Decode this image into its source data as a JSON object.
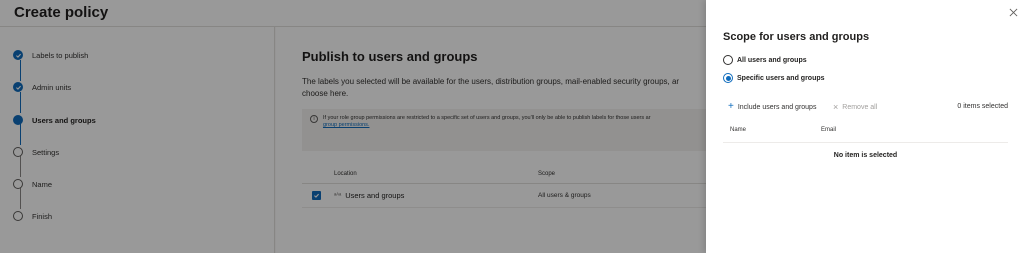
{
  "page": {
    "title": "Create policy"
  },
  "steps": [
    {
      "label": "Labels to publish",
      "state": "done"
    },
    {
      "label": "Admin units",
      "state": "done"
    },
    {
      "label": "Users and groups",
      "state": "current"
    },
    {
      "label": "Settings",
      "state": "pending"
    },
    {
      "label": "Name",
      "state": "pending"
    },
    {
      "label": "Finish",
      "state": "pending"
    }
  ],
  "main": {
    "title": "Publish to users and groups",
    "description": "The labels you selected will be available for the users, distribution groups, mail-enabled security groups, ar choose here.",
    "info_text": "If your role group permissions are restricted to a specific set of users and groups, you'll only be able to publish labels for those users ar",
    "info_link": "group permissions.",
    "table": {
      "headers": {
        "location": "Location",
        "scope": "Scope"
      },
      "rows": [
        {
          "location": "Users and groups",
          "scope": "All users & groups",
          "checked": true
        }
      ]
    }
  },
  "panel": {
    "title": "Scope for users and groups",
    "options": [
      {
        "label": "All users and groups",
        "checked": false
      },
      {
        "label": "Specific users and groups",
        "checked": true
      }
    ],
    "toolbar": {
      "include_label": "Include users and groups",
      "remove_label": "Remove all",
      "count_text": "0 items selected"
    },
    "table": {
      "headers": {
        "name": "Name",
        "email": "Email"
      },
      "empty_text": "No item is selected"
    }
  },
  "colors": {
    "accent": "#0f6cbd",
    "overlay": "rgba(0,0,0,0.40)"
  }
}
